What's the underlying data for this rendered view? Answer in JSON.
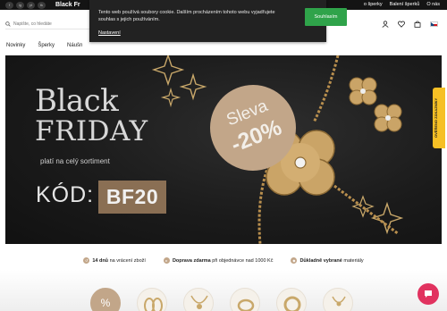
{
  "topbar": {
    "socials": [
      "f",
      "ig",
      "yt",
      "tk"
    ],
    "promo": "Black Fr",
    "links": [
      "o šperky",
      "Balení šperků",
      "O nás"
    ]
  },
  "header": {
    "search_placeholder": "Napište, co hledáte",
    "icons": [
      "user-icon",
      "heart-icon",
      "bag-icon"
    ],
    "language": "cz"
  },
  "nav": {
    "items": [
      "Novinky",
      "Šperky",
      "Náušn"
    ]
  },
  "cookie": {
    "text": "Tento web používá soubory cookie. Dalším procházením tohoto webu vyjadřujete souhlas s jejich používáním.",
    "settings": "Nastavení",
    "agree": "Souhlasím"
  },
  "banner": {
    "title_line1": "Black",
    "title_line2": "FRIDAY",
    "subtitle": "platí na celý sortiment",
    "code_label": "KÓD:",
    "code": "BF20",
    "sale_label": "Sleva",
    "sale_value": "-20%"
  },
  "sidetab": {
    "label": "OVĚŘENO ZÁKAZNÍKY"
  },
  "usp": [
    {
      "bold": "14 dnů",
      "text": " na vrácení zboží"
    },
    {
      "bold": "Doprava zdarma",
      "text": " při objednávce nad 1000 Kč"
    },
    {
      "bold": "Důkladně vybrané",
      "text": " materiály"
    }
  ],
  "categories": {
    "sale_symbol": "%"
  },
  "colors": {
    "accent_gold": "#c2a689",
    "cookie_bg": "#222222",
    "agree_green": "#2fa34a",
    "chat_pink": "#e1325f"
  }
}
